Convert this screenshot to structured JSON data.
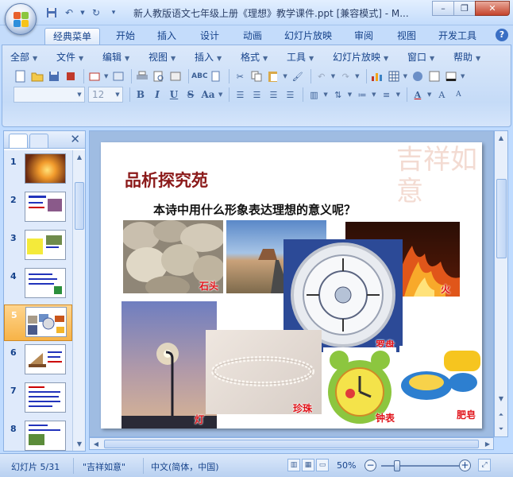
{
  "window": {
    "title": "新人教版语文七年级上册《理想》教学课件.ppt [兼容模式] - M...",
    "controls": [
      "minimize-icon",
      "restore-icon",
      "close-icon"
    ]
  },
  "ribbon_tabs": [
    "经典菜单",
    "开始",
    "插入",
    "设计",
    "动画",
    "幻灯片放映",
    "审阅",
    "视图",
    "开发工具"
  ],
  "active_tab": "经典菜单",
  "classic_menu": [
    "全部",
    "文件",
    "编辑",
    "视图",
    "插入",
    "格式",
    "工具",
    "幻灯片放映",
    "窗口",
    "帮助"
  ],
  "font_size": "12",
  "format_buttons": [
    "B",
    "I",
    "U",
    "S",
    "Aa"
  ],
  "thumbnails": [
    "1",
    "2",
    "3",
    "4",
    "5",
    "6",
    "7",
    "8"
  ],
  "selected_slide": 5,
  "slide": {
    "title": "品析探究苑",
    "question": "本诗中用什么形象表达理想的意义呢？",
    "watermark": "吉祥如意",
    "labels": {
      "stone": "石头",
      "fire": "火",
      "compass": "罗盘",
      "lamp": "灯",
      "pearl": "珍珠",
      "clock": "钟表",
      "soap": "肥皂"
    }
  },
  "status": {
    "slide_info": "幻灯片 5/31",
    "theme": "\"吉祥如意\"",
    "language": "中文(简体，中国)",
    "zoom": "50%"
  },
  "colors": {
    "ribbon_bg": "#c5dbf7",
    "accent_selected": "#f7b347",
    "slide_title": "#8b1a1a",
    "photo_label": "#e1141b"
  }
}
